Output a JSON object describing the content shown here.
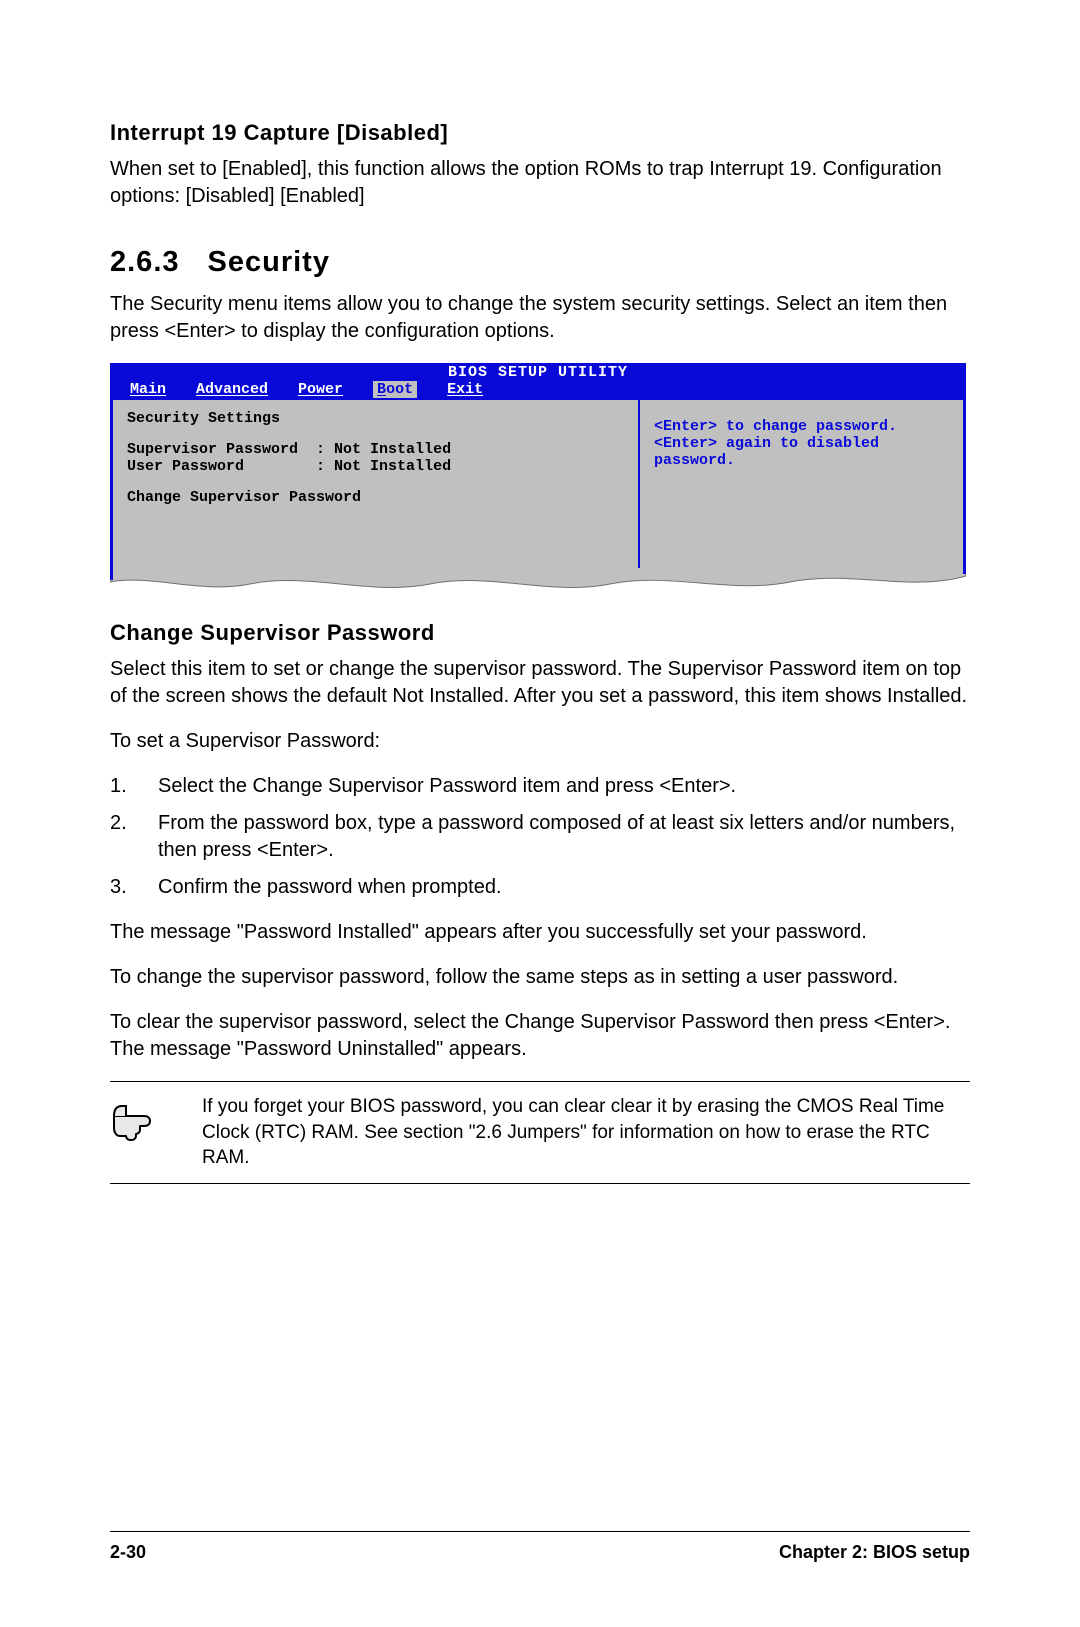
{
  "interrupt": {
    "heading": "Interrupt 19 Capture [Disabled]",
    "body": "When set to [Enabled], this function allows the option ROMs to trap Interrupt 19. Configuration options: [Disabled] [Enabled]"
  },
  "section": {
    "number": "2.6.3",
    "title": "Security",
    "intro": "The Security menu items allow you to change the system security settings. Select an item then press <Enter> to display the configuration options."
  },
  "bios": {
    "title": "BIOS SETUP UTILITY",
    "tabs": [
      "Main",
      "Advanced",
      "Power",
      "Boot",
      "Exit"
    ],
    "active_tab_index": 3,
    "panel_title": "Security Settings",
    "rows": [
      {
        "label": "Supervisor Password",
        "value": "Not Installed"
      },
      {
        "label": "User Password",
        "value": "Not Installed"
      }
    ],
    "action": "Change Supervisor Password",
    "help": "<Enter> to change password.\n<Enter> again to disabled password."
  },
  "change_pw": {
    "heading": "Change Supervisor Password",
    "p1": "Select this item to set or change the supervisor password. The Supervisor Password item on top of the screen shows the default Not Installed. After you set a password, this item shows Installed.",
    "p2": "To set a Supervisor Password:",
    "steps": [
      "Select the Change Supervisor Password item and press <Enter>.",
      "From the password box, type a password composed of at least six letters and/or numbers, then press <Enter>.",
      "Confirm the password when prompted."
    ],
    "p3": "The message \"Password Installed\" appears after you successfully set your password.",
    "p4": "To change the supervisor password, follow the same steps as in setting a user password.",
    "p5": "To clear the supervisor password, select the Change Supervisor Password then press <Enter>. The message \"Password Uninstalled\" appears."
  },
  "note": "If you forget your BIOS password, you can clear clear it by erasing the CMOS Real Time Clock (RTC) RAM. See section \"2.6  Jumpers\" for information on how to erase the RTC RAM.",
  "footer": {
    "page": "2-30",
    "chapter": "Chapter 2: BIOS setup"
  }
}
